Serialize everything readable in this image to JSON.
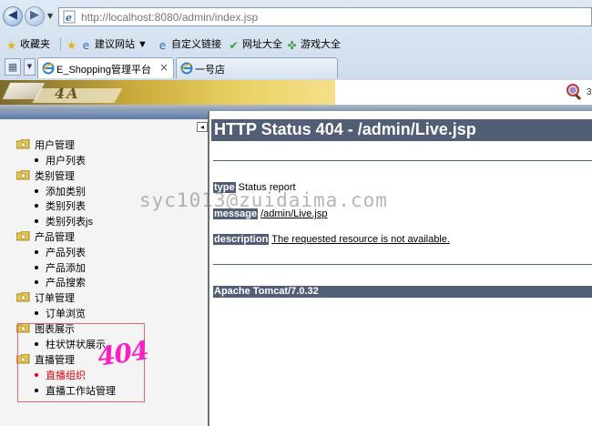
{
  "browser": {
    "url_prefix": "http://localhost",
    "url_rest": ":8080/admin/index.jsp",
    "favorites": [
      {
        "label": "收藏夹",
        "icon": "star-icon"
      },
      {
        "label": "建议网站 ▼",
        "icon": "suggested-sites-icon"
      },
      {
        "label": "自定义链接",
        "icon": "ie-page-icon"
      },
      {
        "label": "网址大全",
        "icon": "check-icon"
      },
      {
        "label": "游戏大全",
        "icon": "game-controller-icon"
      }
    ],
    "tabs": [
      {
        "label": "E_Shopping管理平台",
        "active": true,
        "close": "×"
      },
      {
        "label": "一号店",
        "active": false
      }
    ]
  },
  "header": {
    "logo_text": "4A",
    "right_text": "3"
  },
  "sidebar": {
    "collapse_symbol": "◂",
    "groups": [
      {
        "label": "用户管理",
        "items": [
          {
            "label": "用户列表"
          }
        ]
      },
      {
        "label": "类别管理",
        "items": [
          {
            "label": "添加类别"
          },
          {
            "label": "类别列表"
          },
          {
            "label": "类别列表js"
          }
        ]
      },
      {
        "label": "产品管理",
        "items": [
          {
            "label": "产品列表"
          },
          {
            "label": "产品添加"
          },
          {
            "label": "产品搜索"
          }
        ]
      },
      {
        "label": "订单管理",
        "items": [
          {
            "label": "订单浏览"
          }
        ]
      },
      {
        "label": "图表展示",
        "items": [
          {
            "label": "柱状饼状展示"
          }
        ]
      },
      {
        "label": "直播管理",
        "items": [
          {
            "label": "直播组织",
            "active": true
          },
          {
            "label": "直播工作站管理"
          }
        ]
      }
    ],
    "annotation": "404"
  },
  "error": {
    "title": "HTTP Status 404 - /admin/Live.jsp",
    "type_label": "type",
    "type_value": "Status report",
    "message_label": "message",
    "message_value": "/admin/Live.jsp",
    "description_label": "description",
    "description_value": "The requested resource is not available.",
    "server": "Apache Tomcat/7.0.32"
  },
  "watermark": "syc1013@zuidaima.com",
  "colors": {
    "tomcat_bar": "#525d76",
    "active_link": "#e0000a",
    "annotation": "#ff1fc6"
  }
}
